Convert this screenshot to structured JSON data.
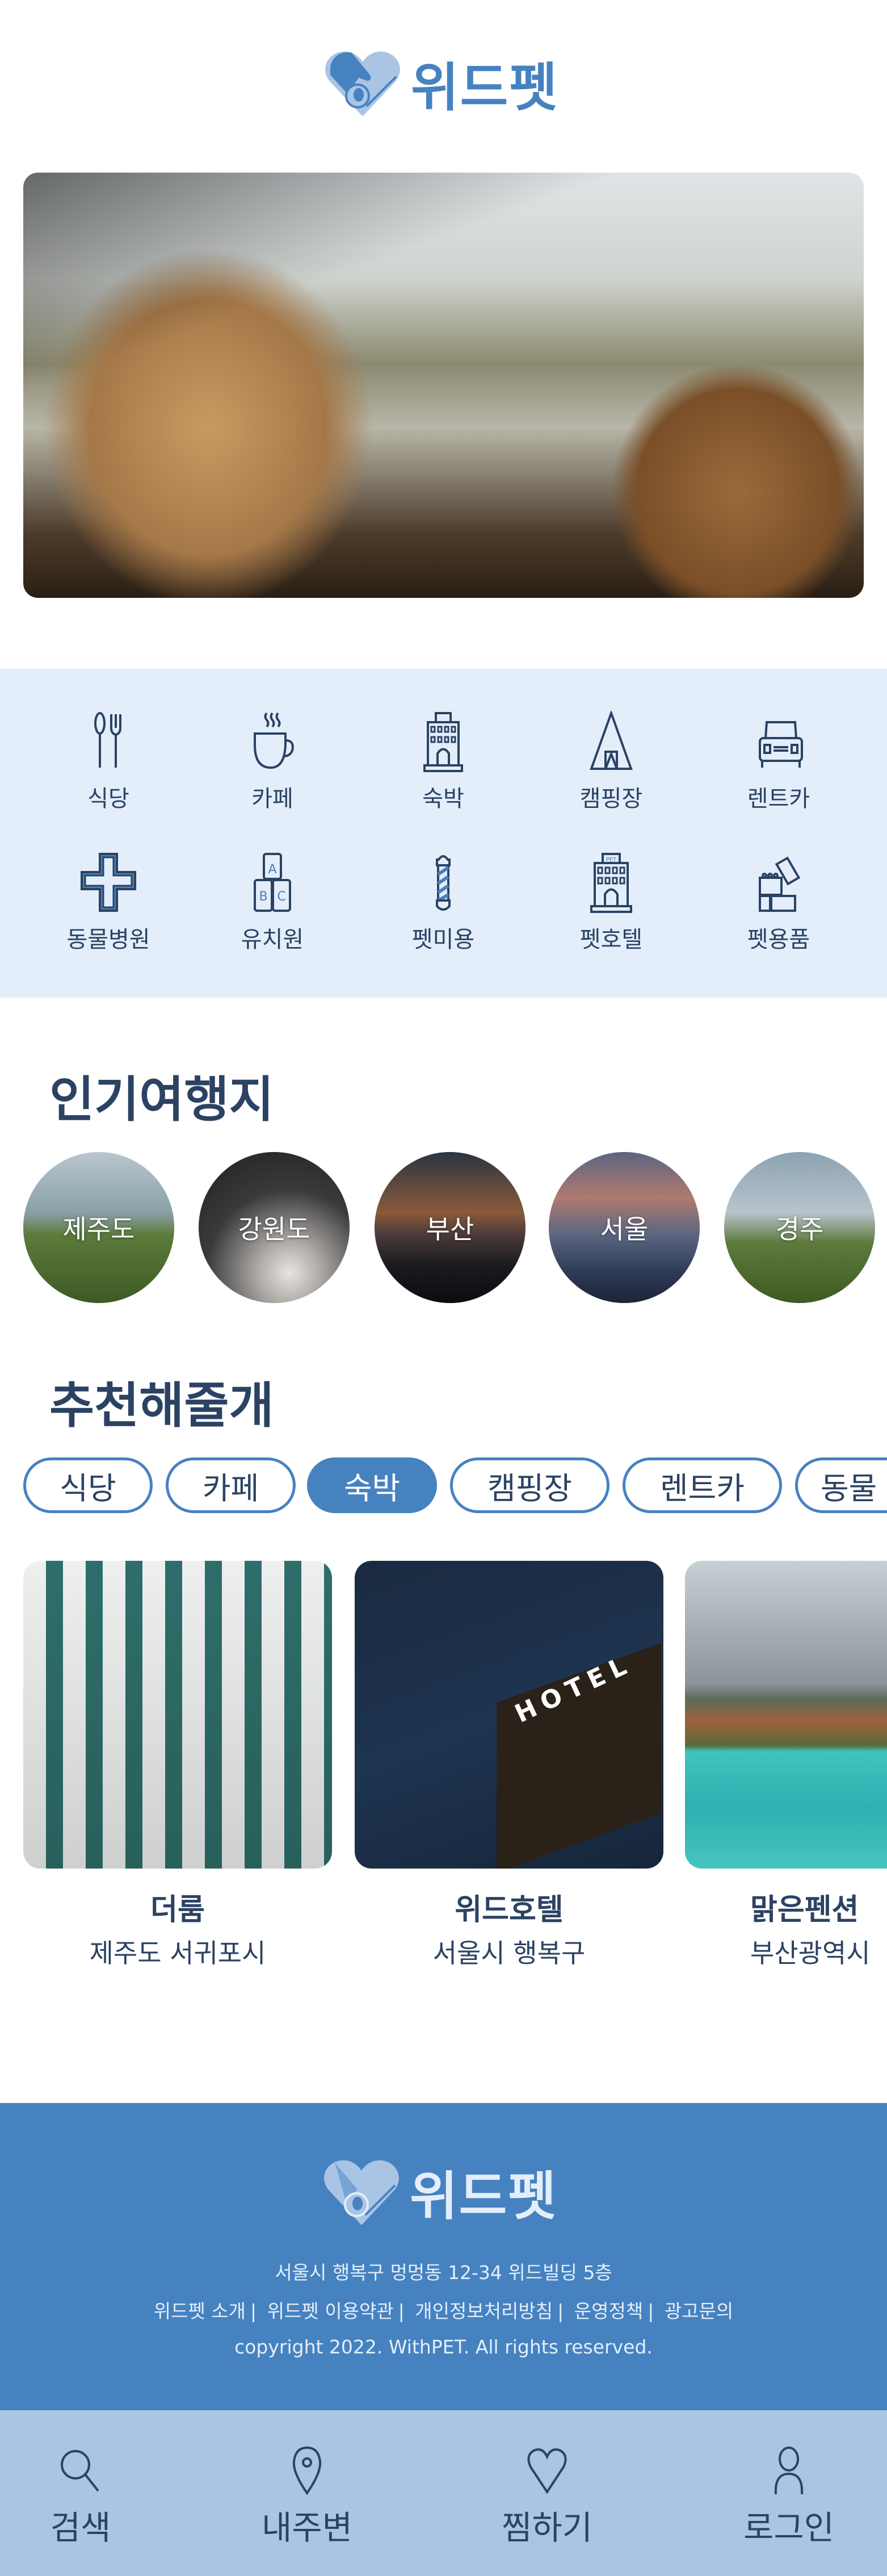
{
  "header": {
    "logo_text": "위드펫"
  },
  "colors": {
    "accent": "#4682c0",
    "navy": "#2b4263",
    "light_bg": "#e3eefa",
    "nav_bg": "#aac4e4"
  },
  "categories": [
    {
      "label": "식당",
      "icon": "utensils-icon"
    },
    {
      "label": "카페",
      "icon": "coffee-cup-icon"
    },
    {
      "label": "숙박",
      "icon": "building-icon"
    },
    {
      "label": "캠핑장",
      "icon": "tent-icon"
    },
    {
      "label": "렌트카",
      "icon": "car-icon"
    },
    {
      "label": "동물병원",
      "icon": "medical-cross-icon"
    },
    {
      "label": "유치원",
      "icon": "abc-blocks-icon"
    },
    {
      "label": "펫미용",
      "icon": "barber-pole-icon"
    },
    {
      "label": "펫호텔",
      "icon": "pet-hotel-icon"
    },
    {
      "label": "펫용품",
      "icon": "toy-blocks-icon"
    }
  ],
  "popular": {
    "title": "인기여행지",
    "destinations": [
      "제주도",
      "강원도",
      "부산",
      "서울",
      "경주"
    ]
  },
  "recommend": {
    "title": "추천해줄개",
    "filters": [
      "식당",
      "카페",
      "숙박",
      "캠핑장",
      "렌트카",
      "동물"
    ],
    "active_filter": "숙박",
    "cards": [
      {
        "name": "더룸",
        "location": "제주도 서귀포시"
      },
      {
        "name": "위드호텔",
        "location": "서울시 행복구"
      },
      {
        "name": "맑은펜션",
        "location": "부산광역시"
      }
    ]
  },
  "footer": {
    "logo_text": "위드펫",
    "address": "서울시 행복구 멍멍동 12-34 위드빌딩 5층",
    "links": [
      "위드펫 소개",
      "위드펫 이용약관",
      "개인정보처리방침",
      "운영정책",
      "광고문의"
    ],
    "copyright": "copyright 2022. WithPET. All rights reserved."
  },
  "nav": [
    {
      "label": "검색",
      "icon": "search-icon"
    },
    {
      "label": "내주변",
      "icon": "location-pin-icon"
    },
    {
      "label": "찜하기",
      "icon": "heart-icon"
    },
    {
      "label": "로그인",
      "icon": "user-icon"
    }
  ]
}
